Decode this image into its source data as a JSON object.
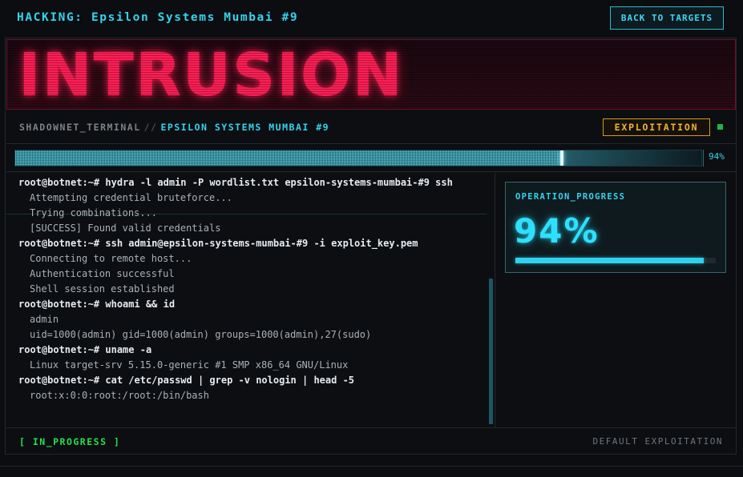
{
  "header": {
    "title": "HACKING: Epsilon Systems Mumbai #9",
    "back_label": "BACK TO TARGETS"
  },
  "banner": {
    "text": "INTRUSION"
  },
  "terminal_bar": {
    "app_name": "SHADOWNET_TERMINAL",
    "separator": "//",
    "target_name": "EPSILON SYSTEMS MUMBAI #9",
    "phase": "EXPLOITATION"
  },
  "progress": {
    "fraction": 0.94,
    "percent_label": "94%"
  },
  "terminal": {
    "lines": [
      {
        "type": "cmd",
        "text": "root@botnet:~# hydra -l admin -P wordlist.txt epsilon-systems-mumbai-#9 ssh"
      },
      {
        "type": "out",
        "text": "Attempting credential bruteforce..."
      },
      {
        "type": "out",
        "text": "Trying combinations..."
      },
      {
        "type": "out",
        "text": "[SUCCESS] Found valid credentials"
      },
      {
        "type": "cmd",
        "text": "root@botnet:~# ssh admin@epsilon-systems-mumbai-#9 -i exploit_key.pem"
      },
      {
        "type": "out",
        "text": "Connecting to remote host..."
      },
      {
        "type": "out",
        "text": "Authentication successful"
      },
      {
        "type": "out",
        "text": "Shell session established"
      },
      {
        "type": "cmd",
        "text": "root@botnet:~# whoami && id"
      },
      {
        "type": "out",
        "text": "admin"
      },
      {
        "type": "out",
        "text": "uid=1000(admin) gid=1000(admin) groups=1000(admin),27(sudo)"
      },
      {
        "type": "cmd",
        "text": "root@botnet:~# uname -a"
      },
      {
        "type": "out",
        "text": "Linux target-srv 5.15.0-generic #1 SMP x86_64 GNU/Linux"
      },
      {
        "type": "cmd",
        "text": "root@botnet:~# cat /etc/passwd | grep -v nologin | head -5"
      },
      {
        "type": "out",
        "text": "root:x:0:0:root:/root:/bin/bash"
      }
    ]
  },
  "operation": {
    "label": "OPERATION_PROGRESS",
    "value_label": "94%",
    "fraction": 0.94
  },
  "footer": {
    "state": "[ IN_PROGRESS ]",
    "mode": "DEFAULT EXPLOITATION"
  },
  "colors": {
    "accent_cyan": "#35d3ee",
    "alert_red": "#ff1f56",
    "phase_amber": "#f3b52a",
    "ok_green": "#27e04e"
  }
}
